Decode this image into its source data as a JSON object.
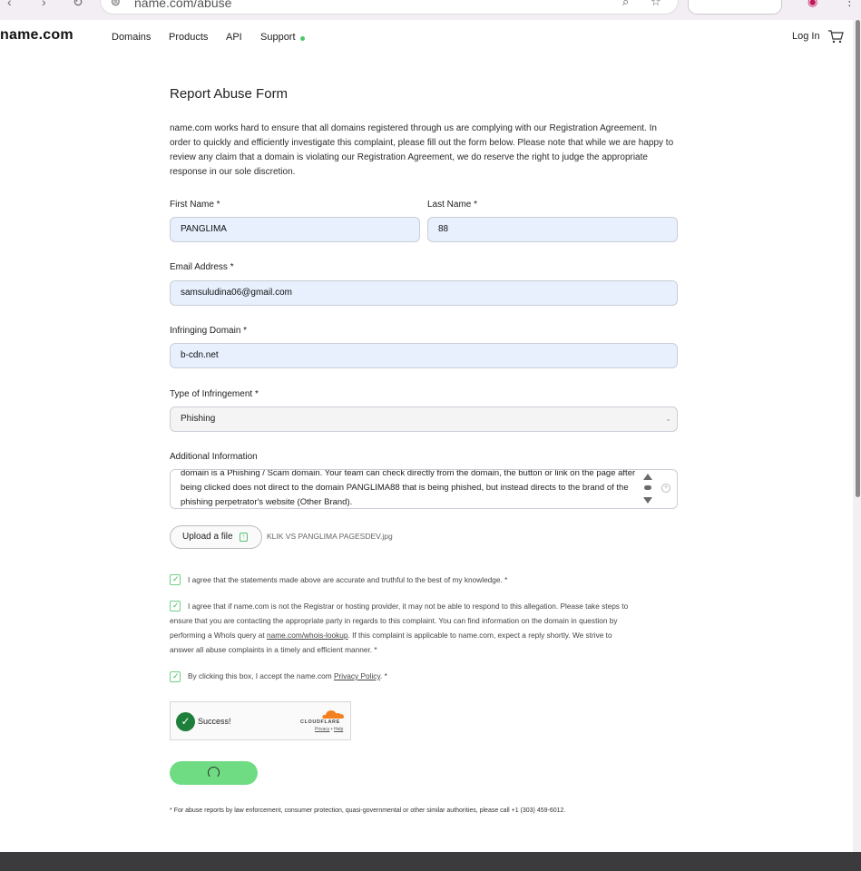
{
  "browser": {
    "url": "name.com/abuse"
  },
  "header": {
    "logo": "name.com",
    "nav": [
      "Domains",
      "Products",
      "API",
      "Support"
    ],
    "login": "Log In"
  },
  "form": {
    "title": "Report Abuse Form",
    "intro": "name.com works hard to ensure that all domains registered through us are complying with our Registration Agreement. In order to quickly and efficiently investigate this complaint, please fill out the form below. Please note that while we are happy to review any claim that a domain is violating our Registration Agreement, we do reserve the right to judge the appropriate response in our sole discretion.",
    "first_name_label": "First Name *",
    "first_name_value": "PANGLIMA",
    "last_name_label": "Last Name *",
    "last_name_value": "88",
    "email_label": "Email Address *",
    "email_value": "samsuludina06@gmail.com",
    "domain_label": "Infringing Domain *",
    "domain_value": "b-cdn.net",
    "type_label": "Type of Infringement *",
    "type_value": "Phishing",
    "info_label": "Additional Information",
    "info_value": "domain is a Phishing / Scam domain. Your team can check directly from the domain, the button or link on the page after being clicked does not direct to the domain PANGLIMA88 that is being phished, but instead directs to the brand of the phishing perpetrator's website (Other Brand).",
    "upload_label": "Upload a file",
    "upload_filename": "KLIK VS PANGLIMA PAGESDEV.jpg",
    "agree_1": "I agree that the statements made above are accurate and truthful to the best of my knowledge. *",
    "agree_2_line1": "I agree that if name.com is not the Registrar or hosting provider, it may not be able to respond to this allegation. Please take steps to",
    "agree_2_line2": "ensure that you are contacting the appropriate party in regards to this complaint. You can find information on the domain in question by",
    "agree_2_pre": "performing a WhoIs query at ",
    "agree_2_link": "name.com/whois-lookup",
    "agree_2_post": ". If this complaint is applicable to name.com, expect a reply shortly. We strive to",
    "agree_2_line4": "answer all abuse complaints in a timely and efficient manner. *",
    "agree_3_pre": "By clicking this box, I accept the name.com ",
    "agree_3_link": "Privacy Policy",
    "agree_3_post": ". *",
    "footnote": "* For abuse reports by law enforcement, consumer protection, quasi-governmental or other similar authorities, please call +1 (303) 459-6012."
  },
  "captcha": {
    "status": "Success!",
    "brand": "CLOUDFLARE",
    "privacy": "Privacy",
    "separator": "•",
    "help": "Help"
  },
  "colors": {
    "accent_green": "#6fdc83",
    "input_bg": "#e8f0fe",
    "footer": "#3b3b3d"
  }
}
